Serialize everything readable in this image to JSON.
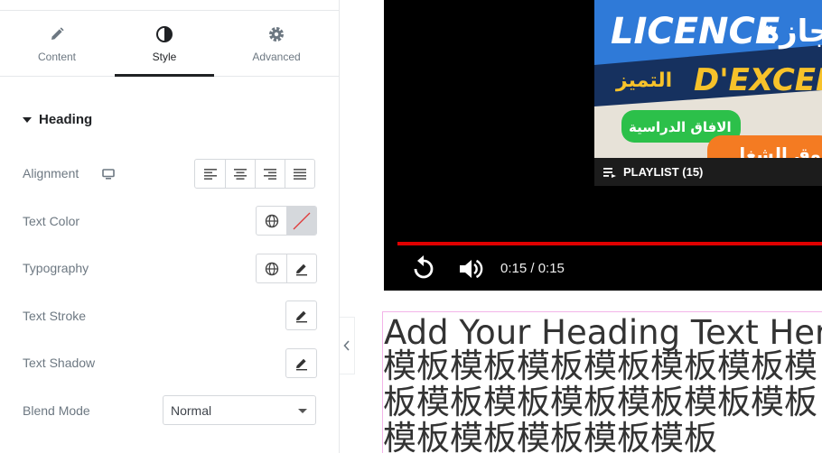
{
  "panel": {
    "tabs": [
      {
        "label": "Content",
        "icon": "pencil-icon"
      },
      {
        "label": "Style",
        "icon": "contrast-icon",
        "active": true
      },
      {
        "label": "Advanced",
        "icon": "gear-icon"
      }
    ],
    "section": {
      "title": "Heading",
      "icon": "caret-down-icon"
    },
    "controls": {
      "alignment": {
        "label": "Alignment",
        "responsive_icon": "desktop-icon",
        "options": [
          "align-left-icon",
          "align-center-icon",
          "align-right-icon",
          "align-justify-icon"
        ]
      },
      "text_color": {
        "label": "Text Color",
        "icons": [
          "globe-icon",
          "no-color-icon"
        ]
      },
      "typography": {
        "label": "Typography",
        "icons": [
          "globe-icon",
          "pencil-icon"
        ]
      },
      "text_stroke": {
        "label": "Text Stroke",
        "icon": "pencil-icon"
      },
      "text_shadow": {
        "label": "Text Shadow",
        "icon": "pencil-icon"
      },
      "blend_mode": {
        "label": "Blend Mode",
        "value": "Normal"
      }
    },
    "collapse_icon": "chevron-left-icon"
  },
  "preview": {
    "video": {
      "thumbnail": {
        "line1": "LICENCE",
        "line2": "D'EXCELLEN",
        "arabic_top": "إجازة",
        "arabic_mid": "التميز",
        "arabic_tag": "الافاق الدراسية",
        "arabic_bottom": "سوق الشغل"
      },
      "playlist_label": "PLAYLIST (15)",
      "time": "0:15 / 0:15",
      "progress": 1.0,
      "icons": [
        "playlist-icon",
        "replay-icon",
        "volume-icon"
      ]
    },
    "heading": "Add Your Heading Text Here",
    "cjk": "模板模板模板模板模板模板模板模板模板模板模板模板模板模板模板模板模板模板"
  },
  "colors": {
    "accent": "#e00000",
    "panel_text": "#6d7882",
    "heading_outline": "#f3b4e9"
  }
}
